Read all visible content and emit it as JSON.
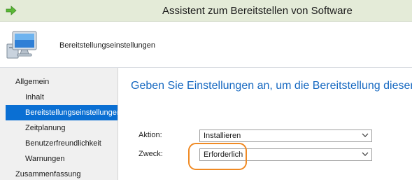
{
  "window": {
    "title": "Assistent zum Bereitstellen von Software",
    "icon": "green-arrow-icon"
  },
  "header": {
    "title": "Bereitstellungseinstellungen",
    "icon": "computer-monitor-icon"
  },
  "sidebar": {
    "items": [
      {
        "label": "Allgemein",
        "level": 0,
        "active": false
      },
      {
        "label": "Inhalt",
        "level": 1,
        "active": false
      },
      {
        "label": "Bereitstellungseinstellungen",
        "level": 1,
        "active": true
      },
      {
        "label": "Zeitplanung",
        "level": 1,
        "active": false
      },
      {
        "label": "Benutzerfreundlichkeit",
        "level": 1,
        "active": false
      },
      {
        "label": "Warnungen",
        "level": 1,
        "active": false
      },
      {
        "label": "Zusammenfassung",
        "level": 0,
        "active": false
      }
    ]
  },
  "main": {
    "instruction": "Geben Sie Einstellungen an, um die Bereitstellung dieser",
    "action": {
      "label": "Aktion:",
      "value": "Installieren"
    },
    "purpose": {
      "label": "Zweck:",
      "value": "Erforderlich"
    }
  },
  "colors": {
    "accent": "#1769c1",
    "selection": "#0a6fd3",
    "highlight": "#f08a24",
    "titlebar": "#e4ebd8"
  }
}
